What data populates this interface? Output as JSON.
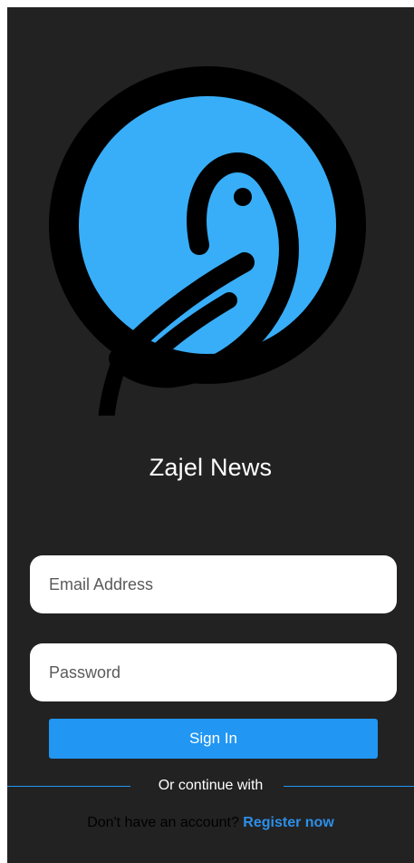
{
  "app": {
    "title": "Zajel News"
  },
  "logo": {
    "icon": "bird-logo-icon",
    "ring_color": "#000000",
    "disc_color": "#38aef8"
  },
  "form": {
    "email": {
      "placeholder": "Email Address",
      "value": ""
    },
    "password": {
      "placeholder": "Password",
      "value": ""
    },
    "sign_in_label": "Sign In"
  },
  "divider": {
    "text": "Or continue with"
  },
  "register": {
    "prompt": "Don't have an account?",
    "link_label": "Register now"
  },
  "colors": {
    "background": "#222222",
    "accent": "#2196f3",
    "text": "#ffffff",
    "field_background": "#ffffff"
  }
}
